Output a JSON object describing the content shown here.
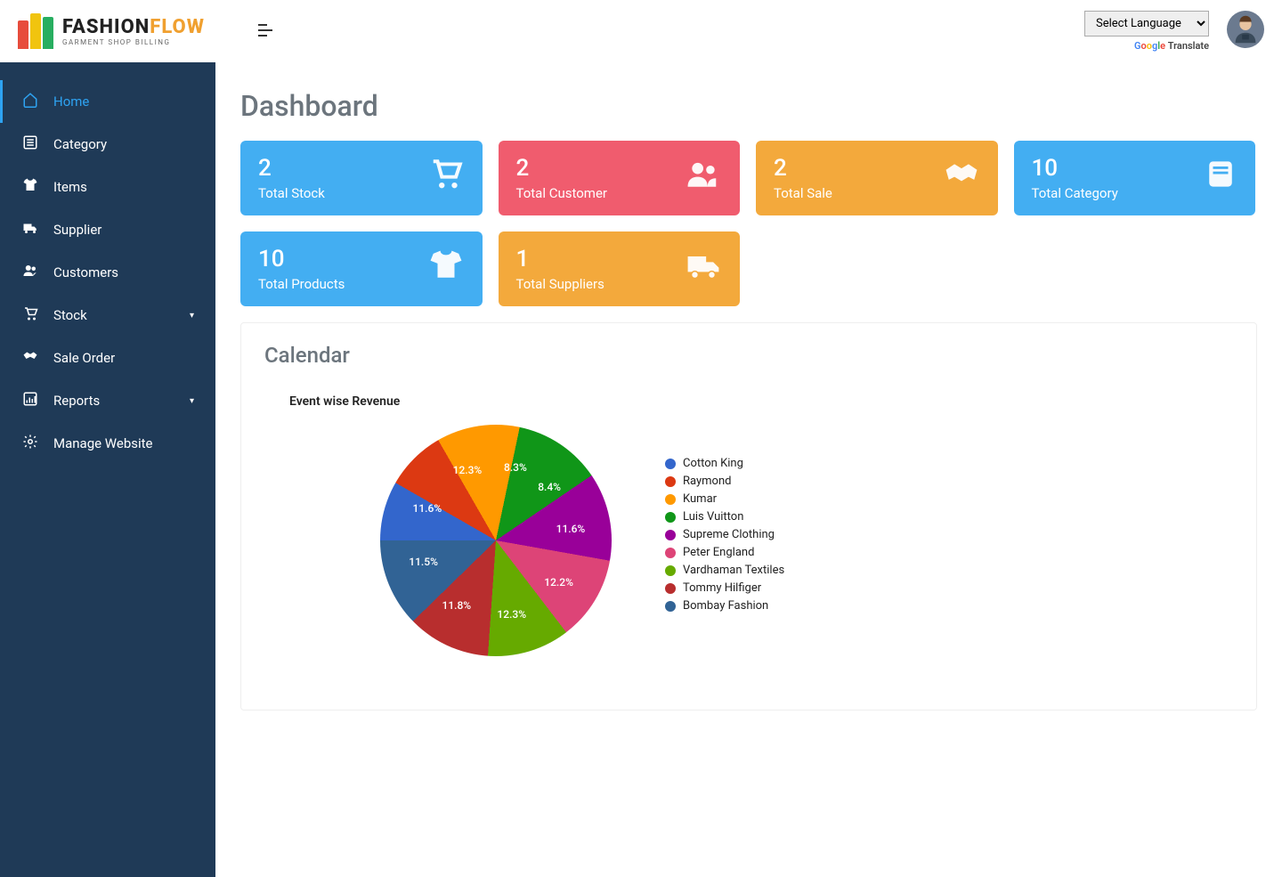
{
  "logo": {
    "line1": "FASHION",
    "line1_accent": "FLOW",
    "line2": "GARMENT SHOP BILLING"
  },
  "lang": {
    "placeholder": "Select Language",
    "translate": "Translate"
  },
  "sidebar": {
    "items": [
      {
        "label": "Home",
        "icon": "home",
        "active": true
      },
      {
        "label": "Category",
        "icon": "list"
      },
      {
        "label": "Items",
        "icon": "tshirt"
      },
      {
        "label": "Supplier",
        "icon": "truck"
      },
      {
        "label": "Customers",
        "icon": "users"
      },
      {
        "label": "Stock",
        "icon": "cart",
        "caret": true
      },
      {
        "label": "Sale Order",
        "icon": "handshake"
      },
      {
        "label": "Reports",
        "icon": "chart",
        "caret": true
      },
      {
        "label": "Manage Website",
        "icon": "gear"
      }
    ]
  },
  "page": {
    "title": "Dashboard"
  },
  "cards": [
    {
      "value": "2",
      "label": "Total Stock",
      "color": "c-blue",
      "icon": "cart"
    },
    {
      "value": "2",
      "label": "Total Customer",
      "color": "c-red",
      "icon": "users"
    },
    {
      "value": "2",
      "label": "Total Sale",
      "color": "c-orange",
      "icon": "handshake"
    },
    {
      "value": "10",
      "label": "Total Category",
      "color": "c-blue",
      "icon": "book"
    },
    {
      "value": "10",
      "label": "Total Products",
      "color": "c-blue",
      "icon": "tshirt"
    },
    {
      "value": "1",
      "label": "Total Suppliers",
      "color": "c-orange",
      "icon": "truck"
    }
  ],
  "panel": {
    "title": "Calendar",
    "chart_title": "Event wise Revenue"
  },
  "chart_data": {
    "type": "pie",
    "title": "Event wise Revenue",
    "series": [
      {
        "name": "Cotton King",
        "value": 8.3,
        "label": "8.3%",
        "color": "#3366cc"
      },
      {
        "name": "Raymond",
        "value": 8.4,
        "label": "8.4%",
        "color": "#dc3912"
      },
      {
        "name": "Kumar",
        "value": 11.6,
        "label": "11.6%",
        "color": "#ff9900"
      },
      {
        "name": "Luis Vuitton",
        "value": 12.2,
        "label": "12.2%",
        "color": "#109618"
      },
      {
        "name": "Supreme Clothing",
        "value": 12.3,
        "label": "12.3%",
        "color": "#990099"
      },
      {
        "name": "Peter England",
        "value": 11.8,
        "label": "11.8%",
        "color": "#dd4477"
      },
      {
        "name": "Vardhaman Textiles",
        "value": 11.5,
        "label": "11.5%",
        "color": "#66aa00"
      },
      {
        "name": "Tommy Hilfiger",
        "value": 11.6,
        "label": "11.6%",
        "color": "#b82e2e"
      },
      {
        "name": "Bombay Fashion",
        "value": 12.3,
        "label": "12.3%",
        "color": "#316395"
      }
    ]
  }
}
